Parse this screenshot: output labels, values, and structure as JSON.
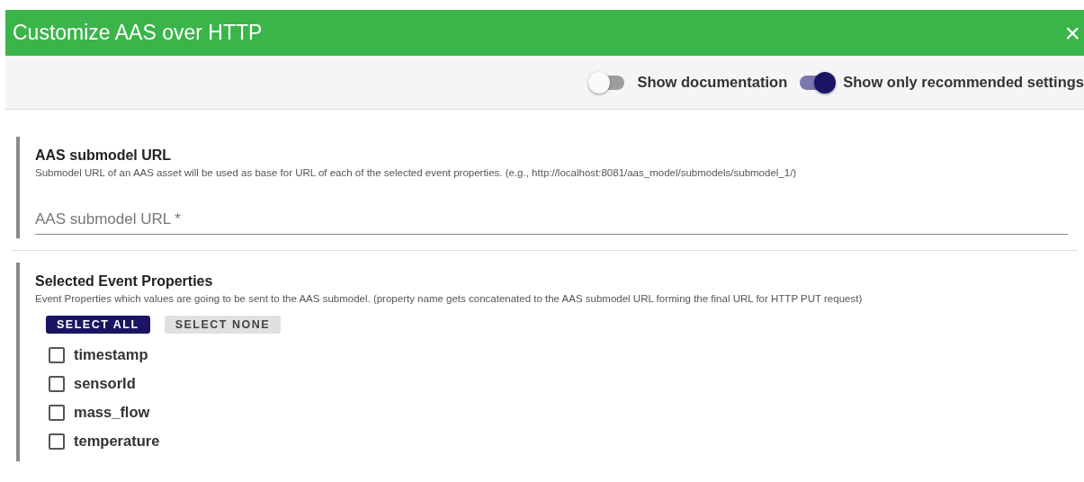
{
  "dialog": {
    "title": "Customize AAS over HTTP",
    "close": "×"
  },
  "toggles": [
    {
      "label": "Show documentation",
      "on": false
    },
    {
      "label": "Show only recommended settings",
      "on": true
    }
  ],
  "sections": [
    {
      "kind": "field",
      "title": "AAS submodel URL",
      "description": "Submodel URL of an AAS asset will be used as base for URL of each of the selected event properties. (e.g., http://localhost:8081/aas_model/submodels/submodel_1/)",
      "placeholder": "AAS submodel URL *"
    },
    {
      "kind": "checklist",
      "title": "Selected Event Properties",
      "description": "Event Properties which values are going to be sent to the AAS submodel. (property name gets concatenated to the AAS submodel URL forming the final URL for HTTP PUT request)",
      "buttons": [
        {
          "label": "SELECT ALL",
          "selected": true
        },
        {
          "label": "SELECT NONE",
          "selected": false
        }
      ],
      "options": [
        {
          "label": "timestamp",
          "checked": false
        },
        {
          "label": "sensorId",
          "checked": false
        },
        {
          "label": "mass_flow",
          "checked": false
        },
        {
          "label": "temperature",
          "checked": false
        }
      ]
    }
  ]
}
